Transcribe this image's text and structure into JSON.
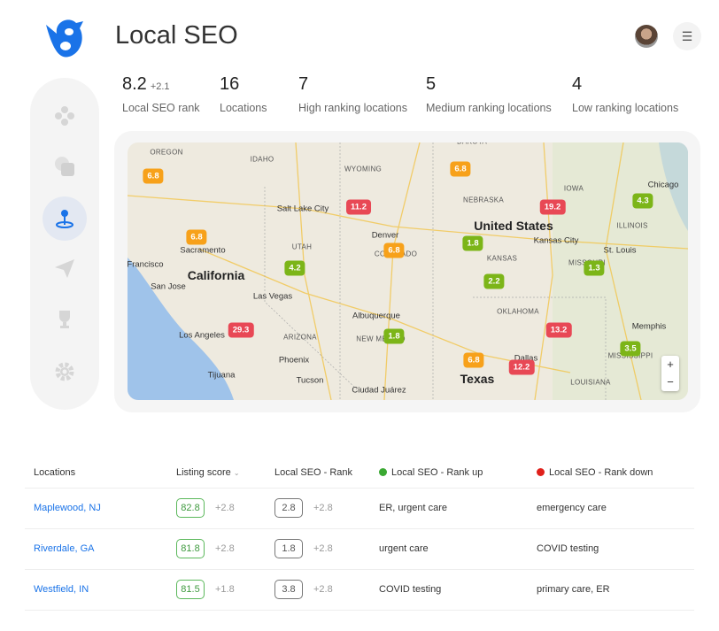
{
  "header": {
    "title": "Local SEO",
    "logo": "bird-logo",
    "menu_icon": "hamburger-icon"
  },
  "stats": [
    {
      "value": "8.2",
      "delta": "+2.1",
      "label": "Local SEO rank"
    },
    {
      "value": "16",
      "label": "Locations"
    },
    {
      "value": "7",
      "label": "High ranking locations"
    },
    {
      "value": "5",
      "label": "Medium ranking locations"
    },
    {
      "value": "4",
      "label": "Low ranking locations"
    }
  ],
  "sidebar": {
    "items": [
      {
        "icon": "dashboard-icon"
      },
      {
        "icon": "layers-icon"
      },
      {
        "icon": "location-pin-icon",
        "active": true
      },
      {
        "icon": "send-icon"
      },
      {
        "icon": "trophy-icon"
      },
      {
        "icon": "gear-icon"
      }
    ]
  },
  "colors": {
    "high": "#7cb518",
    "medium": "#f7a11a",
    "low": "#e84855",
    "link": "#1a73e8",
    "rank_up": "#3aa832",
    "rank_down": "#e0201b"
  },
  "map": {
    "labels": [
      "OREGON",
      "IDAHO",
      "WYOMING",
      "DAKOTA",
      "NEBRASKA",
      "IOWA",
      "Chicago",
      "United States",
      "Salt Lake City",
      "Denver",
      "COLORADO",
      "UTAH",
      "Kansas City",
      "St. Louis",
      "ILLINOIS",
      "KANSAS",
      "MISSOURI",
      "Sacramento",
      "Francisco",
      "California",
      "San Jose",
      "Las Vegas",
      "OKLAHOMA",
      "Albuquerque",
      "Memphis",
      "Los Angeles",
      "ARIZONA",
      "NEW MEXICO",
      "Phoenix",
      "Dallas",
      "Texas",
      "Tijuana",
      "Tucson",
      "Ciudad Juárez",
      "LOUISIANA",
      "MISSISSIPPI"
    ],
    "markers": [
      {
        "value": "6.8",
        "level": "medium"
      },
      {
        "value": "6.8",
        "level": "medium"
      },
      {
        "value": "11.2",
        "level": "low"
      },
      {
        "value": "19.2",
        "level": "low"
      },
      {
        "value": "4.3",
        "level": "high"
      },
      {
        "value": "6.8",
        "level": "medium"
      },
      {
        "value": "6.8",
        "level": "medium"
      },
      {
        "value": "1.8",
        "level": "high"
      },
      {
        "value": "4.2",
        "level": "high"
      },
      {
        "value": "1.3",
        "level": "high"
      },
      {
        "value": "2.2",
        "level": "high"
      },
      {
        "value": "29.3",
        "level": "low"
      },
      {
        "value": "1.8",
        "level": "high"
      },
      {
        "value": "13.2",
        "level": "low"
      },
      {
        "value": "3.5",
        "level": "high"
      },
      {
        "value": "6.8",
        "level": "medium"
      },
      {
        "value": "12.2",
        "level": "low"
      }
    ],
    "zoom_in": "+",
    "zoom_out": "−"
  },
  "table": {
    "headers": [
      "Locations",
      "Listing score",
      "Local SEO - Rank",
      "Local SEO - Rank up",
      "Local SEO - Rank down"
    ],
    "rows": [
      {
        "location": "Maplewood, NJ",
        "score": "82.8",
        "score_delta": "+2.8",
        "rank": "2.8",
        "rank_delta": "+2.8",
        "up": "ER, urgent care",
        "down": "emergency care"
      },
      {
        "location": "Riverdale, GA",
        "score": "81.8",
        "score_delta": "+2.8",
        "rank": "1.8",
        "rank_delta": "+2.8",
        "up": "urgent care",
        "down": "COVID testing"
      },
      {
        "location": "Westfield, IN",
        "score": "81.5",
        "score_delta": "+1.8",
        "rank": "3.8",
        "rank_delta": "+2.8",
        "up": "COVID testing",
        "down": "primary care, ER"
      }
    ]
  }
}
